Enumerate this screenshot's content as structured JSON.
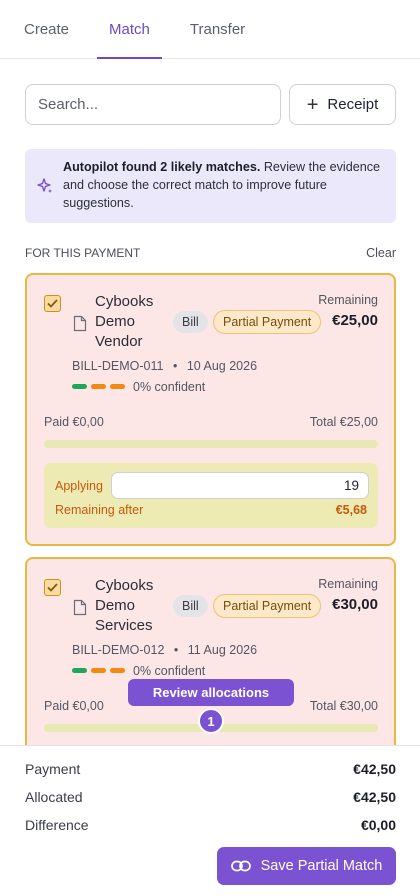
{
  "tabs": [
    {
      "label": "Create",
      "active": false
    },
    {
      "label": "Match",
      "active": true
    },
    {
      "label": "Transfer",
      "active": false
    }
  ],
  "search": {
    "placeholder": "Search..."
  },
  "receipt_button": {
    "label": "Receipt",
    "icon": "plus-icon"
  },
  "autopilot": {
    "icon": "sparkle-icon",
    "headline": "Autopilot found 2 likely matches.",
    "body": " Review the evidence and choose the correct match to improve future suggestions."
  },
  "section": {
    "title": "FOR THIS PAYMENT",
    "clear_label": "Clear"
  },
  "cards": [
    {
      "checked": true,
      "name": "Cybooks Demo Vendor",
      "type_badge": "Bill",
      "status_badge": "Partial Payment",
      "remaining_label": "Remaining",
      "remaining_value": "€25,00",
      "reference": "BILL-DEMO-011",
      "separator": "•",
      "date": "10 Aug 2026",
      "confidence": "0% confident",
      "paid": "Paid €0,00",
      "total": "Total €25,00",
      "paid_fraction": 0,
      "applying_label": "Applying",
      "applying_value": "19",
      "remaining_after_label": "Remaining after",
      "remaining_after_value": "€5,68"
    },
    {
      "checked": true,
      "name": "Cybooks Demo Services",
      "type_badge": "Bill",
      "status_badge": "Partial Payment",
      "remaining_label": "Remaining",
      "remaining_value": "€30,00",
      "reference": "BILL-DEMO-012",
      "separator": "•",
      "date": "11 Aug 2026",
      "confidence": "0% confident",
      "paid": "Paid €0,00",
      "total": "Total €30,00",
      "paid_fraction": 0
    }
  ],
  "review": {
    "label": "Review allocations",
    "count": "1"
  },
  "footer": {
    "payment_label": "Payment",
    "payment_value": "€42,50",
    "allocated_label": "Allocated",
    "allocated_value": "€42,50",
    "difference_label": "Difference",
    "difference_value": "€0,00",
    "save_label": "Save Partial Match",
    "save_icon": "link-icon"
  },
  "colors": {
    "accent": "#6b49c7",
    "button": "#7b52d1",
    "card_bg": "#fde6e6",
    "card_border": "#e8b842",
    "warning_text": "#c65a0b",
    "confidence_dots": [
      "#1fa659",
      "#f08a12",
      "#f08a12"
    ]
  }
}
